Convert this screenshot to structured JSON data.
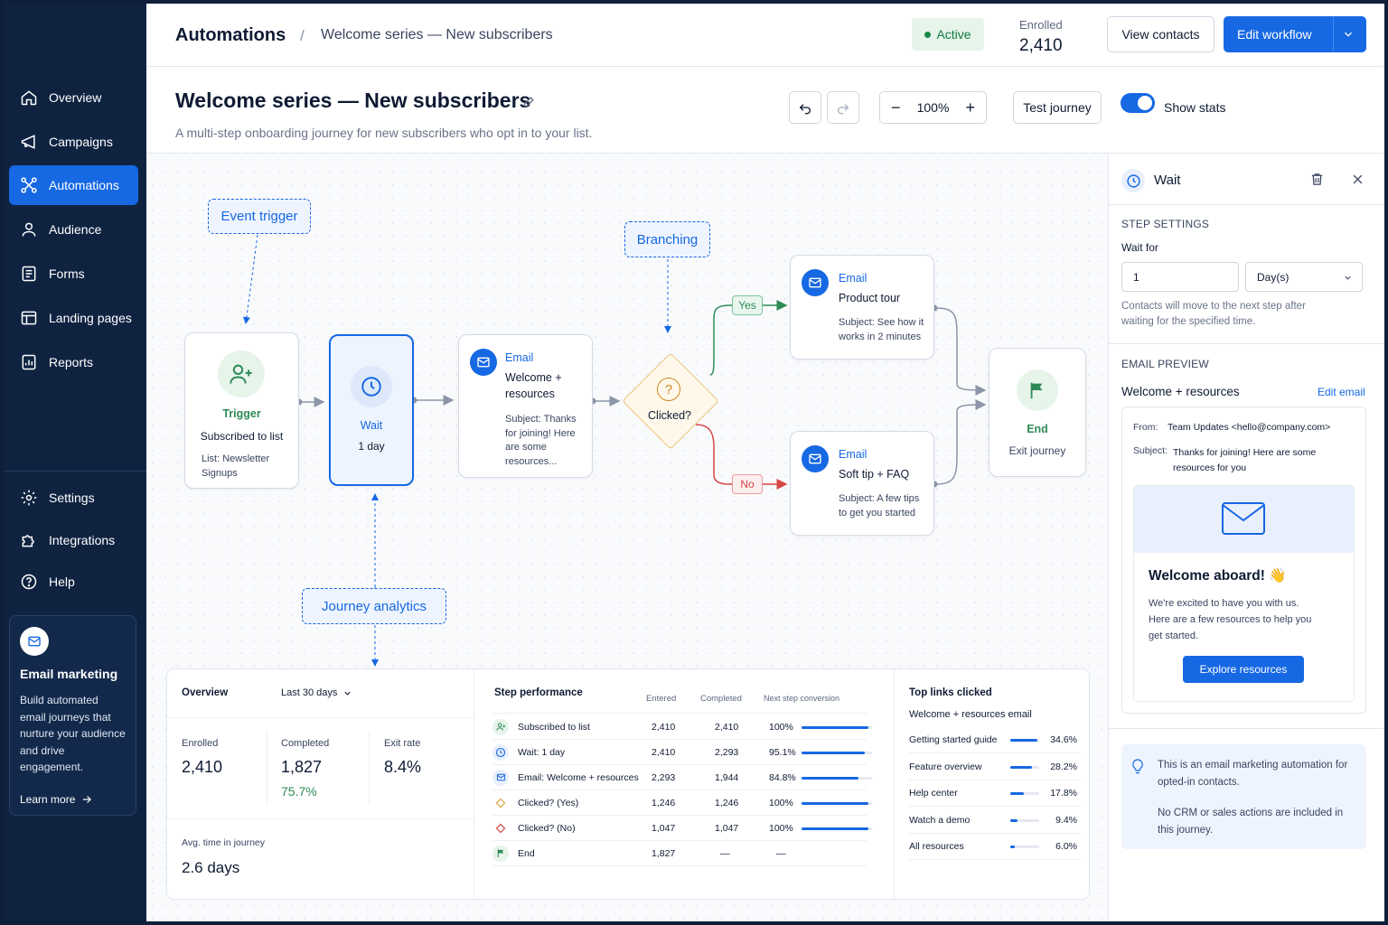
{
  "sidebar": {
    "nav": [
      {
        "label": "Overview",
        "icon": "home-icon"
      },
      {
        "label": "Campaigns",
        "icon": "megaphone-icon"
      },
      {
        "label": "Automations",
        "icon": "workflow-icon"
      },
      {
        "label": "Audience",
        "icon": "user-icon"
      },
      {
        "label": "Forms",
        "icon": "form-icon"
      },
      {
        "label": "Landing pages",
        "icon": "layout-icon"
      },
      {
        "label": "Reports",
        "icon": "report-icon"
      }
    ],
    "active": "Automations",
    "bottom_nav": [
      {
        "label": "Settings",
        "icon": "gear-icon"
      },
      {
        "label": "Integrations",
        "icon": "puzzle-icon"
      },
      {
        "label": "Help",
        "icon": "help-icon"
      }
    ],
    "promo": {
      "title": "Email marketing",
      "description": "Build automated email journeys that nurture your audience and drive engagement.",
      "link": "Learn more"
    }
  },
  "header": {
    "breadcrumb_root": "Automations",
    "breadcrumb_sep": "/",
    "breadcrumb_current": "Welcome series — New subscribers",
    "status": "Active",
    "enrolled_label": "Enrolled",
    "enrolled_value": "2,410",
    "view_contacts": "View contacts",
    "edit_workflow": "Edit workflow"
  },
  "page": {
    "title": "Welcome series — New subscribers",
    "subtitle": "A multi-step onboarding journey for new subscribers who opt in to your list.",
    "zoom": "100%",
    "test_journey": "Test journey",
    "show_stats_label": "Show stats",
    "show_stats": true
  },
  "annotations": {
    "event_trigger": "Event trigger",
    "branching": "Branching",
    "journey_analytics": "Journey analytics"
  },
  "flow": {
    "trigger": {
      "kind": "Trigger",
      "title": "Subscribed to list",
      "detail": "List: Newsletter Signups"
    },
    "wait": {
      "kind": "Wait",
      "detail": "1 day"
    },
    "email1": {
      "kind": "Email",
      "title": "Welcome + resources",
      "subject": "Subject: Thanks for joining! Here are some resources..."
    },
    "decision": {
      "label": "Clicked?"
    },
    "yes_label": "Yes",
    "no_label": "No",
    "email_yes": {
      "kind": "Email",
      "title": "Product tour",
      "subject": "Subject: See how it works in 2 minutes"
    },
    "email_no": {
      "kind": "Email",
      "title": "Soft tip + FAQ",
      "subject": "Subject: A few tips to get you started"
    },
    "end": {
      "kind": "End",
      "detail": "Exit journey"
    },
    "colors": {
      "accent": "#1668e3",
      "yes": "#2e8b57",
      "no": "#d64545",
      "decision": "#e2a53a"
    }
  },
  "analytics": {
    "overview": {
      "title": "Overview",
      "range": "Last 30 days",
      "enrolled_label": "Enrolled",
      "enrolled": "2,410",
      "completed_label": "Completed",
      "completed": "1,827",
      "completed_pct": "75.7%",
      "exit_label": "Exit rate",
      "exit": "8.4%",
      "avg_label": "Avg. time in journey",
      "avg": "2.6 days"
    },
    "steps": {
      "title": "Step performance",
      "columns": [
        "Entered",
        "Completed",
        "Next step conversion"
      ],
      "rows": [
        {
          "name": "Subscribed to list",
          "icon": "user-plus-icon",
          "entered": "2,410",
          "completed": "2,410",
          "conv": "100%",
          "conv_value": 1.0
        },
        {
          "name": "Wait: 1 day",
          "icon": "clock-icon",
          "entered": "2,410",
          "completed": "2,293",
          "conv": "95.1%",
          "conv_value": 0.951
        },
        {
          "name": "Email: Welcome + resources",
          "icon": "mail-icon",
          "entered": "2,293",
          "completed": "1,944",
          "conv": "84.8%",
          "conv_value": 0.848
        },
        {
          "name": "Clicked? (Yes)",
          "icon": "diamond-icon",
          "entered": "1,246",
          "completed": "1,246",
          "conv": "100%",
          "conv_value": 1.0
        },
        {
          "name": "Clicked? (No)",
          "icon": "diamond-icon",
          "entered": "1,047",
          "completed": "1,047",
          "conv": "100%",
          "conv_value": 1.0
        },
        {
          "name": "End",
          "icon": "flag-icon",
          "entered": "1,827",
          "completed": "—",
          "conv": "—",
          "conv_value": null
        }
      ]
    },
    "links": {
      "title": "Top links clicked",
      "subtitle": "Welcome + resources email",
      "rows": [
        {
          "name": "Getting started guide",
          "pct": "34.6%",
          "value": 0.346
        },
        {
          "name": "Feature overview",
          "pct": "28.2%",
          "value": 0.282
        },
        {
          "name": "Help center",
          "pct": "17.8%",
          "value": 0.178
        },
        {
          "name": "Watch a demo",
          "pct": "9.4%",
          "value": 0.094
        },
        {
          "name": "All resources",
          "pct": "6.0%",
          "value": 0.06
        }
      ]
    }
  },
  "panel": {
    "title": "Wait",
    "step_settings": "STEP SETTINGS",
    "wait_for_label": "Wait for",
    "wait_value": "1",
    "wait_unit": "Day(s)",
    "help": "Contacts will move to the next step after waiting for the specified time.",
    "email_preview": "EMAIL PREVIEW",
    "email_name": "Welcome + resources",
    "edit_email": "Edit email",
    "from_label": "From:",
    "from_value": "Team Updates <hello@company.com>",
    "subject_label": "Subject:",
    "subject_value": "Thanks for joining! Here are some resources for you",
    "preview_heading": "Welcome aboard! 👋",
    "preview_body": "We're excited to have you with us. Here are a few resources to help you get started.",
    "preview_cta": "Explore resources",
    "info_1": "This is an email marketing automation for opted-in contacts.",
    "info_2": "No CRM or sales actions are included in this journey."
  }
}
